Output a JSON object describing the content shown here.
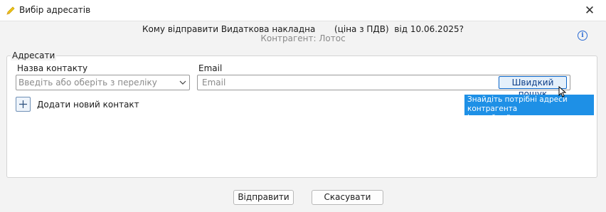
{
  "window": {
    "title": "Вибір адресатів",
    "icon": "pencil-icon"
  },
  "header": {
    "question": "Кому відправити Видаткова накладна",
    "price_note": "(ціна з ПДВ)",
    "date_note": "від 10.06.2025?",
    "counterparty": "Контрагент: Лотос"
  },
  "recipients": {
    "group_label": "Адресати",
    "contact_label": "Назва контакту",
    "contact_placeholder": "Введіть або оберіть з переліку",
    "email_label": "Email",
    "email_placeholder": "Email",
    "quick_search_label": "Швидкий пошук",
    "add_contact_label": "Додати новий контакт"
  },
  "tooltip": {
    "line1": "Знайдіть потрібні адреси контрагента",
    "line2": "і додайте їх до списку адресатів."
  },
  "footer": {
    "send_label": "Відправити",
    "cancel_label": "Скасувати"
  },
  "colors": {
    "accent": "#0a64c8",
    "tooltip_bg": "#1e90e6",
    "info": "#2a6ad3"
  }
}
